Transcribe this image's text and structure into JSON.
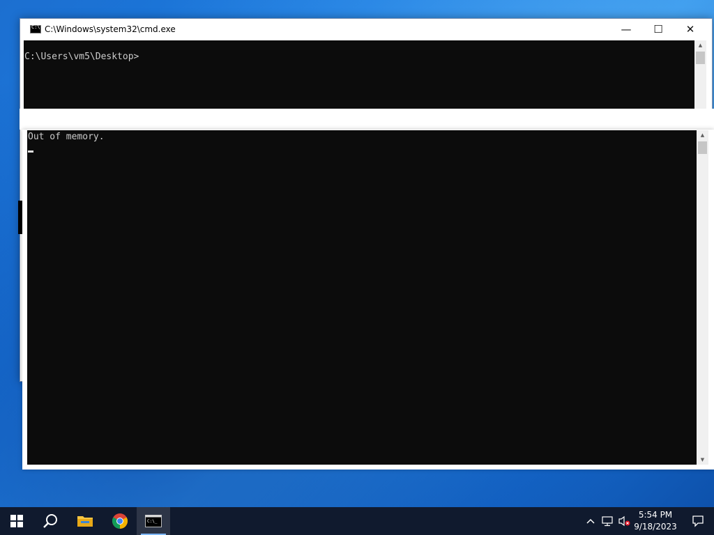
{
  "window": {
    "title": "C:\\Windows\\system32\\cmd.exe",
    "minimize_glyph": "—",
    "maximize_glyph": "☐",
    "close_glyph": "✕"
  },
  "console_top": {
    "prompt": "C:\\Users\\vm5\\Desktop>"
  },
  "console_bottom": {
    "output": "Out of memory."
  },
  "taskbar": {
    "icons": [
      "windows-start-icon",
      "search-icon",
      "file-explorer-icon",
      "chrome-icon",
      "cmd-icon"
    ],
    "tray_icons": [
      "chevron-up-icon",
      "network-icon",
      "volume-muted-icon"
    ],
    "time": "5:54 PM",
    "date": "9/18/2023"
  },
  "colors": {
    "console_bg": "#0c0c0c",
    "console_text": "#cccccc",
    "taskbar_bg": "#101a2e",
    "desktop_blue": "#1a7ae0"
  }
}
